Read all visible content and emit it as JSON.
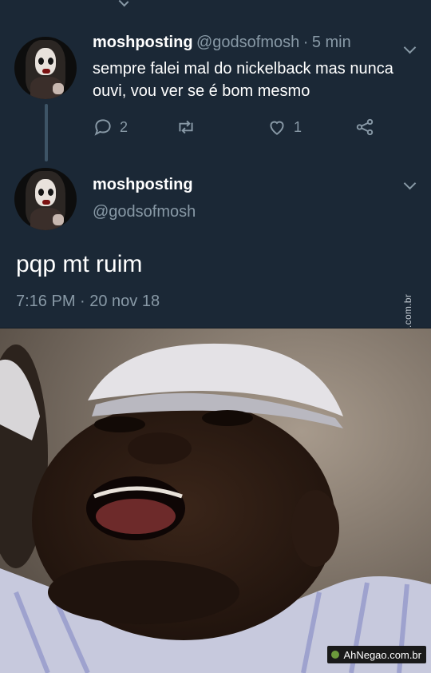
{
  "colors": {
    "background": "#1b2836",
    "text": "#ffffff",
    "muted": "#8899a6",
    "thread_line": "#3d5466"
  },
  "tweet1": {
    "display_name": "moshposting",
    "handle": "@godsofmosh",
    "separator": "·",
    "time": "5 min",
    "text": "sempre falei mal do nickelback mas nunca ouvi, vou ver se é bom mesmo",
    "reply_count": "2",
    "like_count": "1"
  },
  "tweet2": {
    "display_name": "moshposting",
    "handle": "@godsofmosh",
    "text": "pqp mt ruim",
    "timestamp": "7:16 PM · 20 nov 18"
  },
  "watermarks": {
    "vertical": "AhNegao.com.br",
    "badge": "AhNegao.com.br"
  },
  "icons": {
    "reply": "reply-icon",
    "retweet": "retweet-icon",
    "like": "heart-icon",
    "share": "share-icon",
    "more": "chevron-down-icon"
  }
}
